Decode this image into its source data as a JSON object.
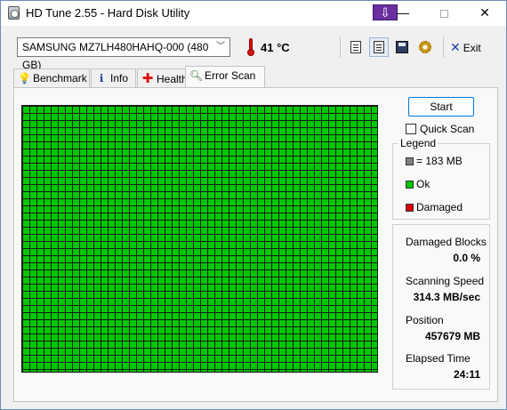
{
  "window": {
    "title": "HD Tune 2.55 - Hard Disk Utility",
    "pin_symbol": "⇩",
    "minimize_symbol": "—",
    "close_symbol": "✕"
  },
  "toolbar": {
    "drive": "SAMSUNG MZ7LH480HAHQ-000 (480 GB)",
    "temperature": "41 °C",
    "exit_label": "Exit"
  },
  "tabs": [
    {
      "label": "Benchmark",
      "icon": "bulb-icon"
    },
    {
      "label": "Info",
      "icon": "info-icon"
    },
    {
      "label": "Health",
      "icon": "health-cross-icon"
    },
    {
      "label": "Error Scan",
      "icon": "magnifier-icon"
    }
  ],
  "active_tab": "Error Scan",
  "scan": {
    "start_label": "Start",
    "quick_scan_label": "Quick Scan",
    "quick_scan_checked": false,
    "grid_color": "#00c800"
  },
  "legend": {
    "title": "Legend",
    "block_size": "= 183 MB",
    "ok": "Ok",
    "damaged": "Damaged",
    "colors": {
      "block": "#808080",
      "ok": "#00c800",
      "damaged": "#dd0000"
    }
  },
  "stats": {
    "damaged_blocks_label": "Damaged Blocks",
    "damaged_blocks_value": "0.0 %",
    "speed_label": "Scanning Speed",
    "speed_value": "314.3 MB/sec",
    "position_label": "Position",
    "position_value": "457679 MB",
    "elapsed_label": "Elapsed Time",
    "elapsed_value": "24:11"
  }
}
